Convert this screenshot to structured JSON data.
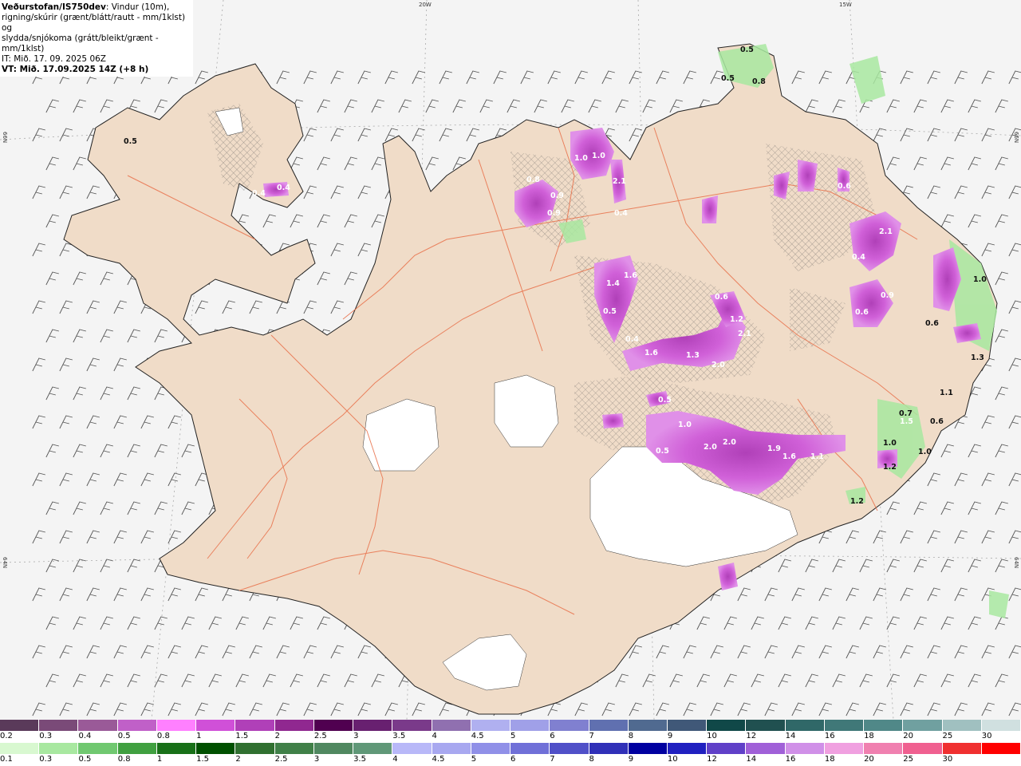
{
  "header": {
    "title": "Veðurstofan/IS750dev",
    "description_line1": ": Vindur (10m),",
    "description_line2": "rigning/skúrir (grænt/blátt/rautt - mm/1klst) og",
    "description_line3": "slydda/snjókoma (grátt/bleikt/grænt - mm/1klst)",
    "issue_time": "IT: Mið. 17. 09. 2025 06Z",
    "valid_time": "VT: Mið. 17.09.2025 14Z (+8 h)"
  },
  "grid_labels": {
    "lon_20w": "20W",
    "lon_15w": "15W",
    "lat_66n_left": "66N",
    "lat_66n_right": "66N",
    "lat_64n_left": "64N",
    "lat_64n_right": "64N"
  },
  "colors": {
    "land": "#f0dcc8",
    "sea": "#f4f4f4",
    "glacier": "#ffffff",
    "roads": "#e8704a",
    "snow_precip": "#c040c8",
    "rain_precip": "#70d070"
  },
  "legend_snow": {
    "labels": [
      "0.2",
      "0.3",
      "0.4",
      "0.5",
      "0.8",
      "1",
      "1.5",
      "2",
      "2.5",
      "3",
      "3.5",
      "4",
      "4.5",
      "5",
      "6",
      "7",
      "8",
      "9",
      "10",
      "12",
      "14",
      "16",
      "18",
      "20",
      "25",
      "30"
    ],
    "colors": [
      "#5a3a5a",
      "#7a4a78",
      "#9a5a98",
      "#c060c8",
      "#ff80ff",
      "#d050d8",
      "#b040b8",
      "#902890",
      "#500050",
      "#682070",
      "#7a3a8a",
      "#9070b0",
      "#b0b0f0",
      "#a0a0e8",
      "#8080d0",
      "#6070b0",
      "#506a90",
      "#405878",
      "#104848",
      "#205050",
      "#306868",
      "#407878",
      "#508888",
      "#70a0a0",
      "#a0c0c0",
      "#d0e0e0"
    ]
  },
  "legend_rain": {
    "labels": [
      "0.1",
      "0.3",
      "0.5",
      "0.8",
      "1",
      "1.5",
      "2",
      "2.5",
      "3",
      "3.5",
      "4",
      "4.5",
      "5",
      "6",
      "7",
      "8",
      "9",
      "10",
      "12",
      "14",
      "16",
      "18",
      "20",
      "25",
      "30"
    ],
    "colors": [
      "#d8f8d0",
      "#a8e8a0",
      "#70c870",
      "#40a040",
      "#187018",
      "#005000",
      "#307030",
      "#408048",
      "#508860",
      "#609878",
      "#b8b8f8",
      "#a8a8f0",
      "#9090e8",
      "#7070d8",
      "#5050c8",
      "#3030b8",
      "#0000a0",
      "#2020c0",
      "#6040c8",
      "#a060d8",
      "#d090e8",
      "#f0a0e0",
      "#f080b0",
      "#f06090",
      "#f03030",
      "#ff0000"
    ]
  },
  "precip_labels": [
    {
      "id": "p1",
      "text": "0.5"
    },
    {
      "id": "p2",
      "text": "0.5"
    },
    {
      "id": "p3",
      "text": "0.8"
    },
    {
      "id": "p4",
      "text": "0.4"
    },
    {
      "id": "p5",
      "text": "0.4"
    },
    {
      "id": "p6",
      "text": "0.5"
    },
    {
      "id": "p7",
      "text": "0.8"
    },
    {
      "id": "p8",
      "text": "1.0"
    },
    {
      "id": "p9",
      "text": "1.0"
    },
    {
      "id": "p10",
      "text": "2.1"
    },
    {
      "id": "p11",
      "text": "0.4"
    },
    {
      "id": "p12",
      "text": "0.9"
    },
    {
      "id": "p13",
      "text": "0.9"
    },
    {
      "id": "p14",
      "text": "1.4"
    },
    {
      "id": "p15",
      "text": "1.6"
    },
    {
      "id": "p16",
      "text": "0.5"
    },
    {
      "id": "p17",
      "text": "0.4"
    },
    {
      "id": "p18",
      "text": "1.6"
    },
    {
      "id": "p19",
      "text": "1.3"
    },
    {
      "id": "p20",
      "text": "2.0"
    },
    {
      "id": "p21",
      "text": "2.1"
    },
    {
      "id": "p22",
      "text": "0.6"
    },
    {
      "id": "p23",
      "text": "1.2"
    },
    {
      "id": "p24",
      "text": "0.9"
    },
    {
      "id": "p25",
      "text": "0.6"
    },
    {
      "id": "p26",
      "text": "2.1"
    },
    {
      "id": "p27",
      "text": "1.0"
    },
    {
      "id": "p28",
      "text": "2.0"
    },
    {
      "id": "p29",
      "text": "2.0"
    },
    {
      "id": "p30",
      "text": "1.9"
    },
    {
      "id": "p31",
      "text": "1.6"
    },
    {
      "id": "p32",
      "text": "1.1"
    },
    {
      "id": "p33",
      "text": "0.5"
    },
    {
      "id": "p34",
      "text": "0.7"
    },
    {
      "id": "p35",
      "text": "1.0"
    },
    {
      "id": "p36",
      "text": "1.5"
    },
    {
      "id": "p37",
      "text": "0.6"
    },
    {
      "id": "p38",
      "text": "1.0"
    },
    {
      "id": "p39",
      "text": "1.2"
    },
    {
      "id": "p40",
      "text": "1.3"
    },
    {
      "id": "p41",
      "text": "0.6"
    },
    {
      "id": "p42",
      "text": "1.0"
    },
    {
      "id": "p43",
      "text": "1.1"
    },
    {
      "id": "p44",
      "text": "0.4"
    },
    {
      "id": "p45",
      "text": "0.6"
    },
    {
      "id": "p46",
      "text": "0.5"
    },
    {
      "id": "p47",
      "text": "1.2"
    }
  ]
}
